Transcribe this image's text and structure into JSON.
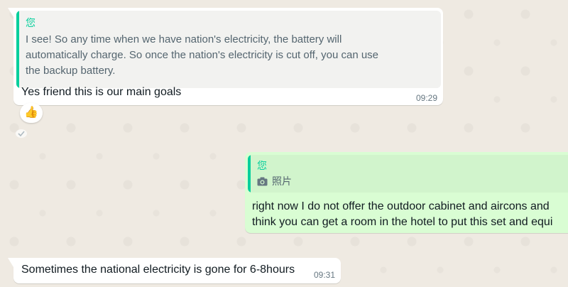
{
  "messages": [
    {
      "reply_author": "您",
      "reply_text": "I see! So any time when we have nation's electricity, the battery will automatically charge. So once the nation's electricity is cut off, you can use the backup battery.",
      "text": "Yes friend this is our main goals",
      "time": "09:29",
      "reaction": "👍"
    },
    {
      "reply_author": "您",
      "reply_media_label": "照片",
      "text_line1": "right now I do not offer the outdoor cabinet and aircons and",
      "text_line2": "think you can get a room in the hotel to put this set and equi"
    },
    {
      "text": "Sometimes the national electricity is gone for 6-8hours",
      "time": "09:31"
    }
  ],
  "colors": {
    "incoming_bubble": "#ffffff",
    "outgoing_bubble": "#d9fdd3",
    "quote_bar": "#06cf9c",
    "chat_background": "#efeae2"
  }
}
